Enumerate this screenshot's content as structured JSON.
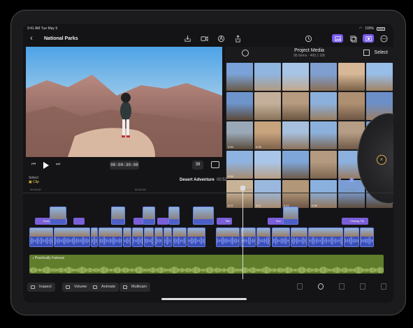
{
  "status_bar": {
    "time": "9:41 AM",
    "date": "Tue May 9",
    "battery": "100%"
  },
  "toolbar": {
    "title": "National Parks"
  },
  "viewer": {
    "timecode": "00:00:30:08",
    "zoom": "38"
  },
  "browser": {
    "title": "Project Media",
    "subtitle": "95 Items · 400.1 GB",
    "select_label": "Select",
    "thumbs": [
      {
        "dur": "",
        "c1": "#7aa2d8",
        "c2": "#6b5a48"
      },
      {
        "dur": "",
        "c1": "#8fb5e0",
        "c2": "#b29a80"
      },
      {
        "dur": "",
        "c1": "#a7c4e6",
        "c2": "#c2a88c"
      },
      {
        "dur": "",
        "c1": "#7e9fd0",
        "c2": "#8b6f55"
      },
      {
        "dur": "",
        "c1": "#d6b796",
        "c2": "#7a6048"
      },
      {
        "dur": "",
        "c1": "#98bde6",
        "c2": "#a18365"
      },
      {
        "dur": "",
        "c1": "#6e94cc",
        "c2": "#5c4a3a"
      },
      {
        "dur": "",
        "c1": "#c4b09a",
        "c2": "#8a735a"
      },
      {
        "dur": "",
        "c1": "#b79b80",
        "c2": "#6b5642"
      },
      {
        "dur": "",
        "c1": "#8cb0dc",
        "c2": "#9a7e62"
      },
      {
        "dur": "",
        "c1": "#ae8f72",
        "c2": "#6e5744"
      },
      {
        "dur": "",
        "c1": "#6d8fc8",
        "c2": "#9b7f64"
      },
      {
        "dur": "0:53",
        "c1": "#9aa9b8",
        "c2": "#5a4a3c"
      },
      {
        "dur": "0:33",
        "c1": "#c7a37e",
        "c2": "#7d6149"
      },
      {
        "dur": "",
        "c1": "#a7c0de",
        "c2": "#8c735c"
      },
      {
        "dur": "",
        "c1": "#8cb0dc",
        "c2": "#7a6452"
      },
      {
        "dur": "",
        "c1": "#b59c84",
        "c2": "#6f5947"
      },
      {
        "dur": "",
        "c1": "#7b9fd4",
        "c2": "#8a6e55"
      },
      {
        "dur": "0:34",
        "c1": "#8fb3e0",
        "c2": "#a68a6e"
      },
      {
        "dur": "",
        "c1": "#a9c6ea",
        "c2": "#b89f86"
      },
      {
        "dur": "",
        "c1": "#7fa6d8",
        "c2": "#6e5a48"
      },
      {
        "dur": "",
        "c1": "#b49a80",
        "c2": "#7c654f"
      },
      {
        "dur": "",
        "c1": "#8cb1df",
        "c2": "#977a60"
      },
      {
        "dur": "",
        "c1": "#5e80b8",
        "c2": "#4a3c30"
      },
      {
        "dur": "0:27",
        "c1": "#c9b396",
        "c2": "#7e6650"
      },
      {
        "dur": "0:17",
        "c1": "#9ab8de",
        "c2": "#a88c70"
      },
      {
        "dur": "0:17",
        "c1": "#b29778",
        "c2": "#6e5644"
      },
      {
        "dur": "0:35",
        "c1": "#8ab0de",
        "c2": "#8f7459"
      },
      {
        "dur": "",
        "c1": "#7a9ed4",
        "c2": "#5e4c3c"
      },
      {
        "dur": "",
        "c1": "#6e8fc4",
        "c2": "#5a4838"
      }
    ]
  },
  "timeline": {
    "select_label": "Select",
    "clip_label": "Clip",
    "project_name": "Desert Adventure",
    "project_duration": "00:52",
    "ruler": [
      "00:00:00",
      "00:00:15",
      "00:00:30",
      "00:00:45"
    ],
    "titles": [
      "Essential Title",
      "",
      "",
      "",
      "Title",
      "Sun",
      "Closing Titl"
    ],
    "broll_labels": [
      "",
      "",
      "",
      "",
      "",
      ""
    ],
    "primary_labels": [
      "",
      "Natural",
      "",
      "",
      "",
      "",
      "",
      "",
      "",
      "",
      "",
      "",
      "",
      "",
      "",
      "Dunes",
      ""
    ],
    "music_label": "Practically Famous"
  },
  "bottom_bar": {
    "inspect": "Inspect",
    "volume": "Volume",
    "animate": "Animate",
    "multicam": "Multicam"
  }
}
